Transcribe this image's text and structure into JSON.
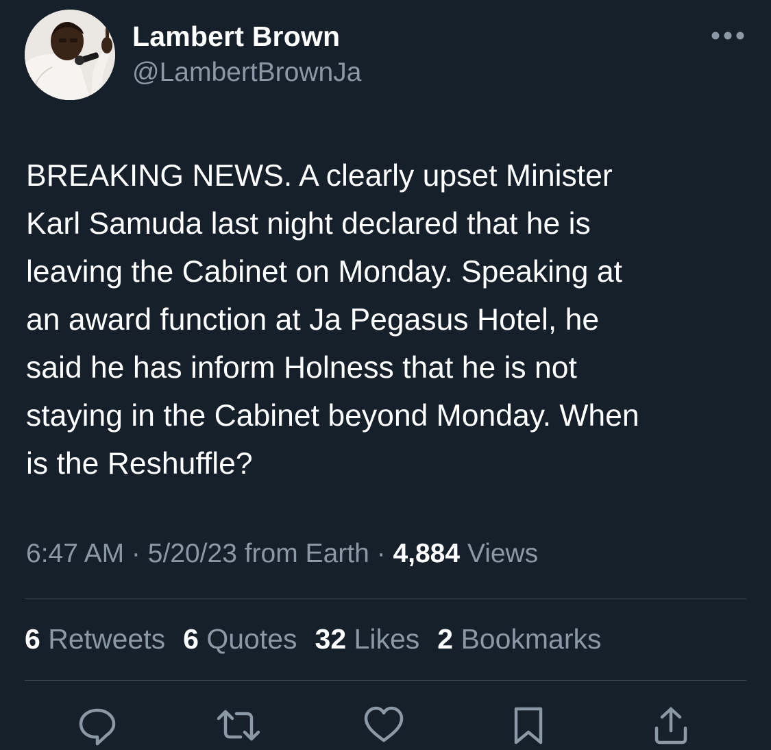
{
  "author": {
    "display_name": "Lambert Brown",
    "handle": "@LambertBrownJa",
    "avatar_icon": "profile-photo"
  },
  "more_icon": "ellipsis-icon",
  "tweet": {
    "text": "BREAKING NEWS. A clearly upset Minister\nKarl Samuda last night declared that he is\nleaving the Cabinet on Monday. Speaking at\nan award function at Ja Pegasus Hotel, he\nsaid he has inform Holness that he is not\nstaying in the Cabinet beyond Monday. When\nis the Reshuffle?"
  },
  "meta": {
    "time": "6:47 AM",
    "sep1": " · ",
    "date": "5/20/23",
    "source": " from Earth",
    "sep2": " · ",
    "views_count": "4,884",
    "views_label": " Views"
  },
  "stats": [
    {
      "count": "6",
      "label": " Retweets"
    },
    {
      "count": "6",
      "label": " Quotes"
    },
    {
      "count": "32",
      "label": " Likes"
    },
    {
      "count": "2",
      "label": " Bookmarks"
    }
  ],
  "actions": [
    "reply-icon",
    "retweet-icon",
    "like-icon",
    "bookmark-icon",
    "share-icon"
  ],
  "colors": {
    "background": "#15202b",
    "primary_text": "#ffffff",
    "secondary_text": "#8b98a5",
    "divider": "#38444d"
  }
}
